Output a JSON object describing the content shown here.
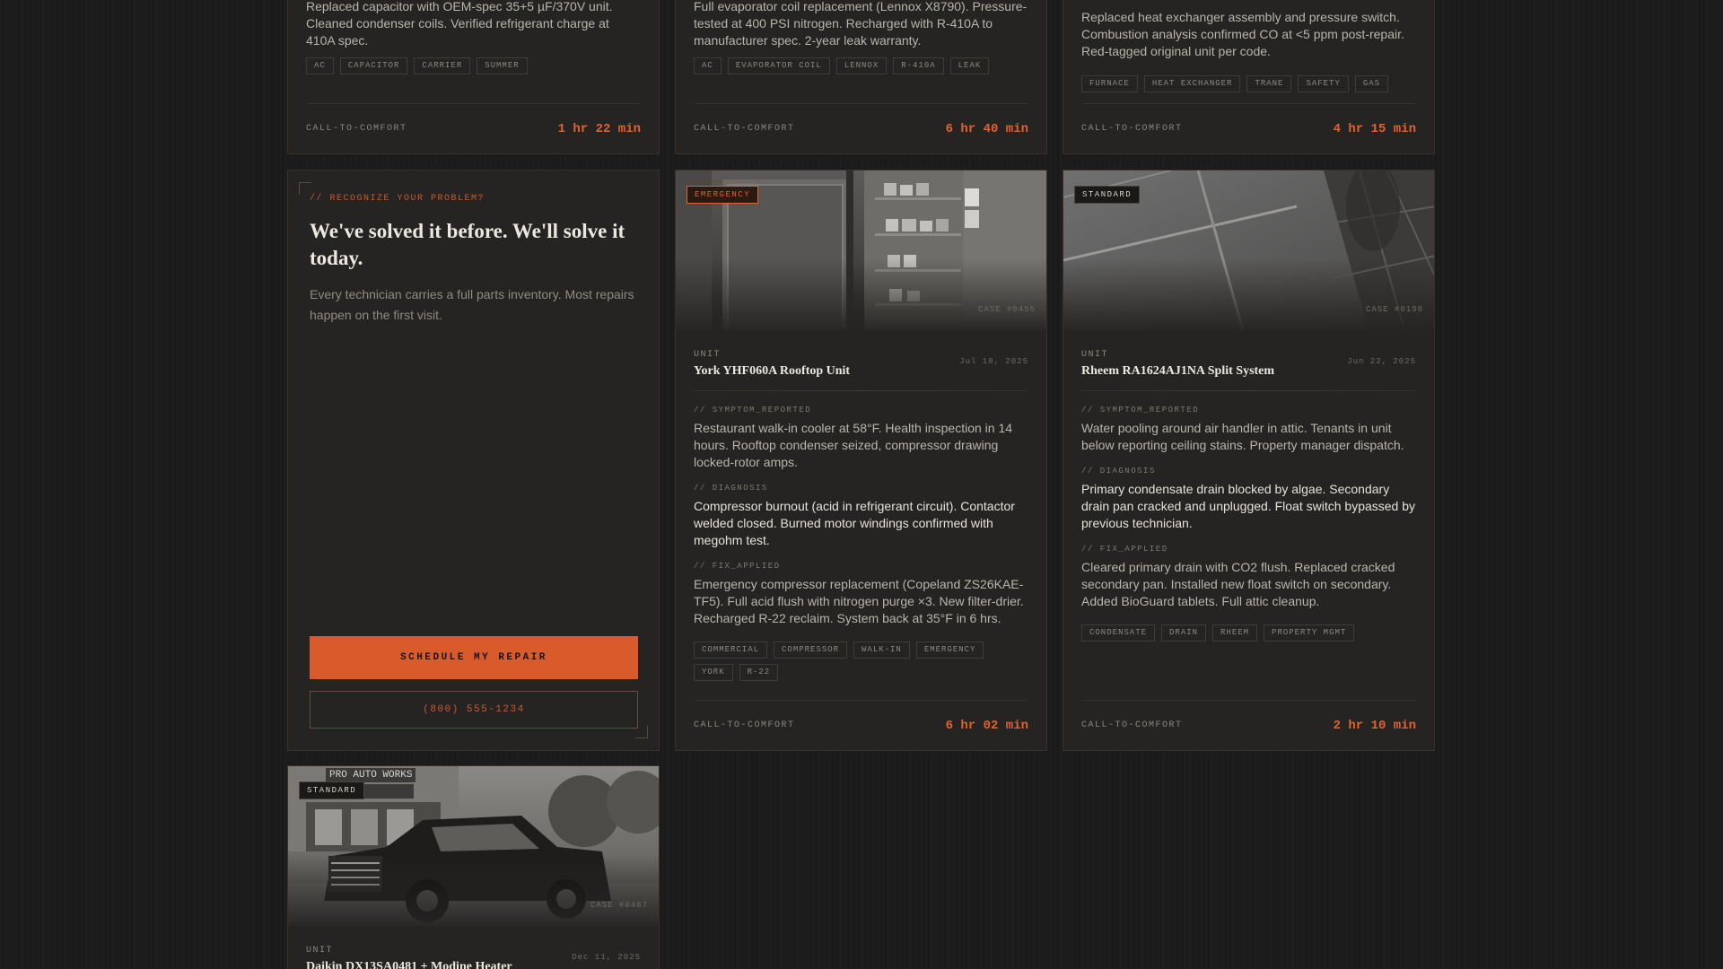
{
  "footer_label": "CALL-TO-COMFORT",
  "top_cards": [
    {
      "fix_text": "Replaced capacitor with OEM-spec 35+5 µF/370V unit. Cleaned condenser coils. Verified refrigerant charge at 410A spec.",
      "tags": [
        "AC",
        "CAPACITOR",
        "CARRIER",
        "SUMMER"
      ],
      "time": "1 hr 22 min"
    },
    {
      "fix_text": "Full evaporator coil replacement (Lennox X8790). Pressure-tested at 400 PSI nitrogen. Recharged with R-410A to manufacturer spec. 2-year leak warranty.",
      "tags": [
        "AC",
        "EVAPORATOR COIL",
        "LENNOX",
        "R-410A",
        "LEAK"
      ],
      "time": "6 hr 40 min"
    },
    {
      "fix_text": "Replaced heat exchanger assembly and pressure switch. Combustion analysis confirmed CO at <5 ppm post-repair. Red-tagged original unit per code.",
      "tags": [
        "FURNACE",
        "HEAT EXCHANGER",
        "TRANE",
        "SAFETY",
        "GAS"
      ],
      "time": "4 hr 15 min"
    }
  ],
  "cta": {
    "kicker": "// RECOGNIZE YOUR PROBLEM?",
    "title": "We've solved it before. We'll solve it today.",
    "body": "Every technician carries a full parts inventory. Most repairs happen on the first visit.",
    "primary_label": "SCHEDULE MY REPAIR",
    "phone_label": "(800) 555-1234"
  },
  "labels": {
    "unit": "UNIT",
    "symptom": "// SYMPTOM_REPORTED",
    "diagnosis": "// DIAGNOSIS",
    "fix": "// FIX_APPLIED"
  },
  "cases": [
    {
      "badge": "EMERGENCY",
      "case_id": "CASE #0455",
      "unit": "York YHF060A Rooftop Unit",
      "date": "Jul 18, 2025",
      "symptom": "Restaurant walk-in cooler at 58°F. Health inspection in 14 hours. Rooftop condenser seized, compressor drawing locked-rotor amps.",
      "diagnosis": "Compressor burnout (acid in refrigerant circuit). Contactor welded closed. Burned motor windings confirmed with megohm test.",
      "fix": "Emergency compressor replacement (Copeland ZS26KAE-TF5). Full acid flush with nitrogen purge ×3. New filter-drier. Recharged R-22 reclaim. System back at 35°F in 6 hrs.",
      "tags": [
        "COMMERCIAL",
        "COMPRESSOR",
        "WALK-IN",
        "EMERGENCY",
        "YORK",
        "R-22"
      ],
      "time": "6 hr 02 min"
    },
    {
      "badge": "STANDARD",
      "case_id": "CASE #0198",
      "unit": "Rheem RA1624AJ1NA Split System",
      "date": "Jun 22, 2025",
      "symptom": "Water pooling around air handler in attic. Tenants in unit below reporting ceiling stains. Property manager dispatch.",
      "diagnosis": "Primary condensate drain blocked by algae. Secondary drain pan cracked and unplugged. Float switch bypassed by previous technician.",
      "fix": "Cleared primary drain with CO2 flush. Replaced cracked secondary pan. Installed new float switch on secondary. Added BioGuard tablets. Full attic cleanup.",
      "tags": [
        "CONDENSATE",
        "DRAIN",
        "RHEEM",
        "PROPERTY MGMT"
      ],
      "time": "2 hr 10 min"
    },
    {
      "badge": "STANDARD",
      "case_id": "CASE #0467",
      "unit": "Daikin DX13SA0481 + Modine Heater",
      "date": "Dec 11, 2025",
      "photo_sign": "PRO AUTO WORKS"
    }
  ]
}
